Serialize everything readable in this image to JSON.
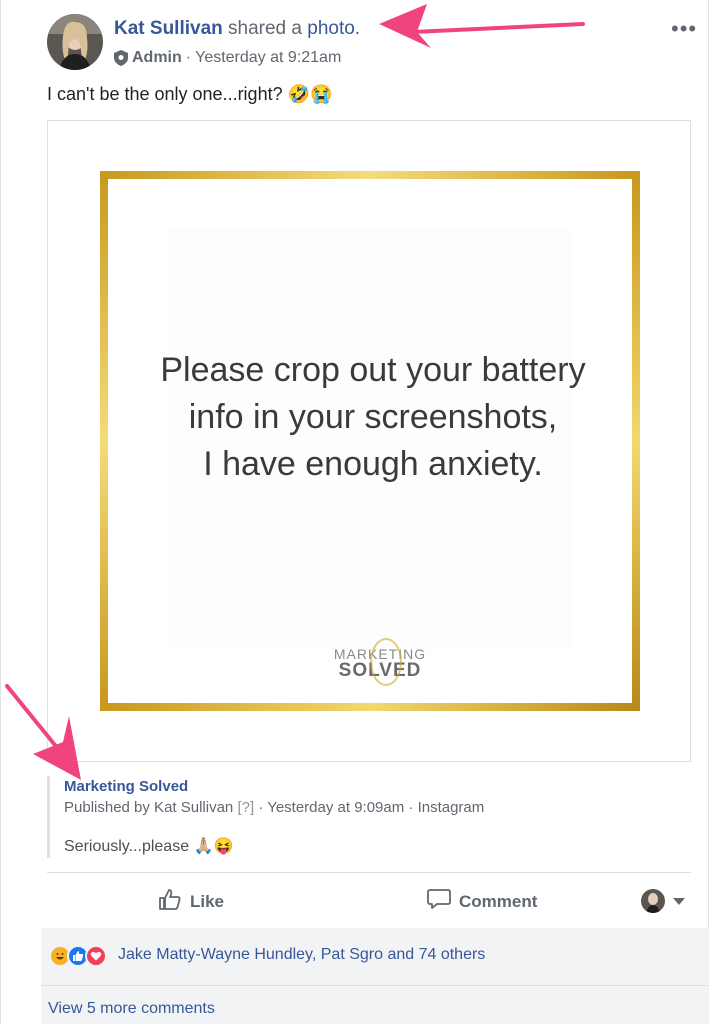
{
  "post": {
    "author": "Kat Sullivan",
    "shared_text": "shared a",
    "photo_link": "photo.",
    "role": "Admin",
    "separator": "·",
    "timestamp": "Yesterday at 9:21am",
    "more_label": "•••",
    "text": "I can't be the only one...right? 🤣😭"
  },
  "image": {
    "quote_lines": [
      "Please crop out your battery",
      "info in your screenshots,",
      "I have enough anxiety."
    ],
    "logo_line1": "MARKETING",
    "logo_line2": "SOLVED"
  },
  "attribution": {
    "page_name": "Marketing Solved",
    "published_by": "Published by Kat Sullivan",
    "help": "[?]",
    "meta_rest": "· Yesterday at 9:09am · Instagram",
    "text": "Seriously...please 🙏🏼😝"
  },
  "actions": {
    "like": "Like",
    "comment": "Comment"
  },
  "footer": {
    "reactors": "Jake Matty-Wayne Hundley, Pat Sgro and 74 others",
    "view_more": "View 5 more comments"
  },
  "colors": {
    "link_blue": "#365899",
    "arrow_pink": "#f0457c",
    "gold": "#d4a92a"
  }
}
